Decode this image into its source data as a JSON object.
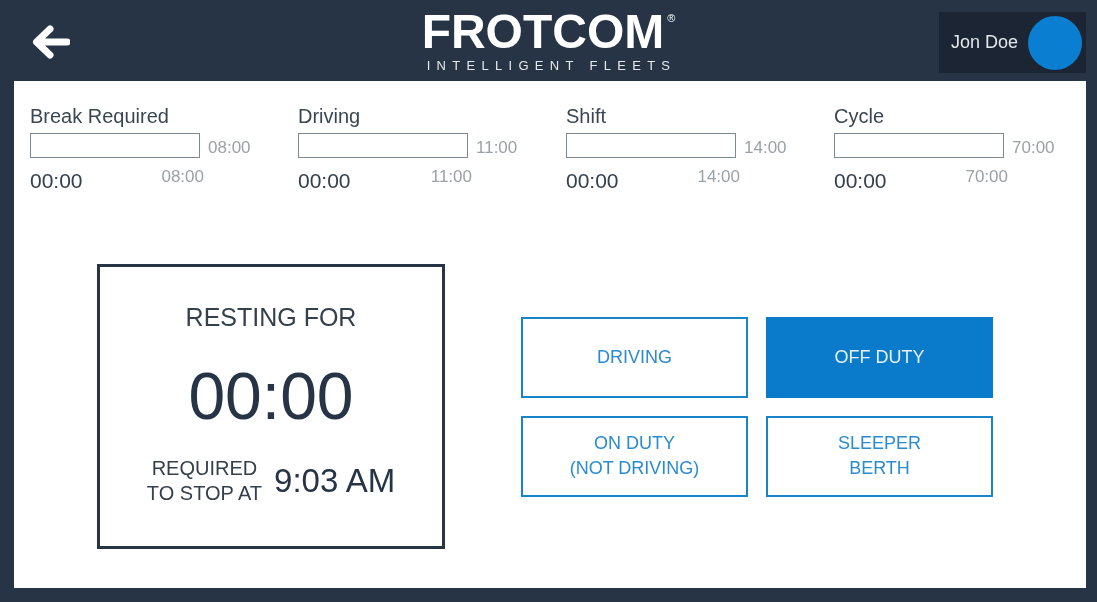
{
  "header": {
    "logo": {
      "wordmark": "FROTCOM",
      "registered_mark": "®",
      "tagline": "INTELLIGENT FLEETS"
    },
    "user": {
      "name": "Jon Doe"
    }
  },
  "meters": [
    {
      "label": "Break Required",
      "level": 0,
      "limit": "08:00",
      "elapsed": "00:00",
      "scale_end": "08:00"
    },
    {
      "label": "Driving",
      "level": 0,
      "limit": "11:00",
      "elapsed": "00:00",
      "scale_end": "11:00"
    },
    {
      "label": "Shift",
      "level": 0,
      "limit": "14:00",
      "elapsed": "00:00",
      "scale_end": "14:00"
    },
    {
      "label": "Cycle",
      "level": 0,
      "limit": "70:00",
      "elapsed": "00:00",
      "scale_end": "70:00"
    }
  ],
  "resting": {
    "title": "RESTING FOR",
    "duration": "00:00",
    "stop_label": "REQUIRED\nTO STOP AT",
    "stop_time": "9:03 AM"
  },
  "statuses": [
    {
      "label": "DRIVING",
      "selected": false
    },
    {
      "label": "OFF DUTY",
      "selected": true
    },
    {
      "label": "ON DUTY\n(NOT DRIVING)",
      "selected": false
    },
    {
      "label": "SLEEPER\nBERTH",
      "selected": false
    }
  ]
}
